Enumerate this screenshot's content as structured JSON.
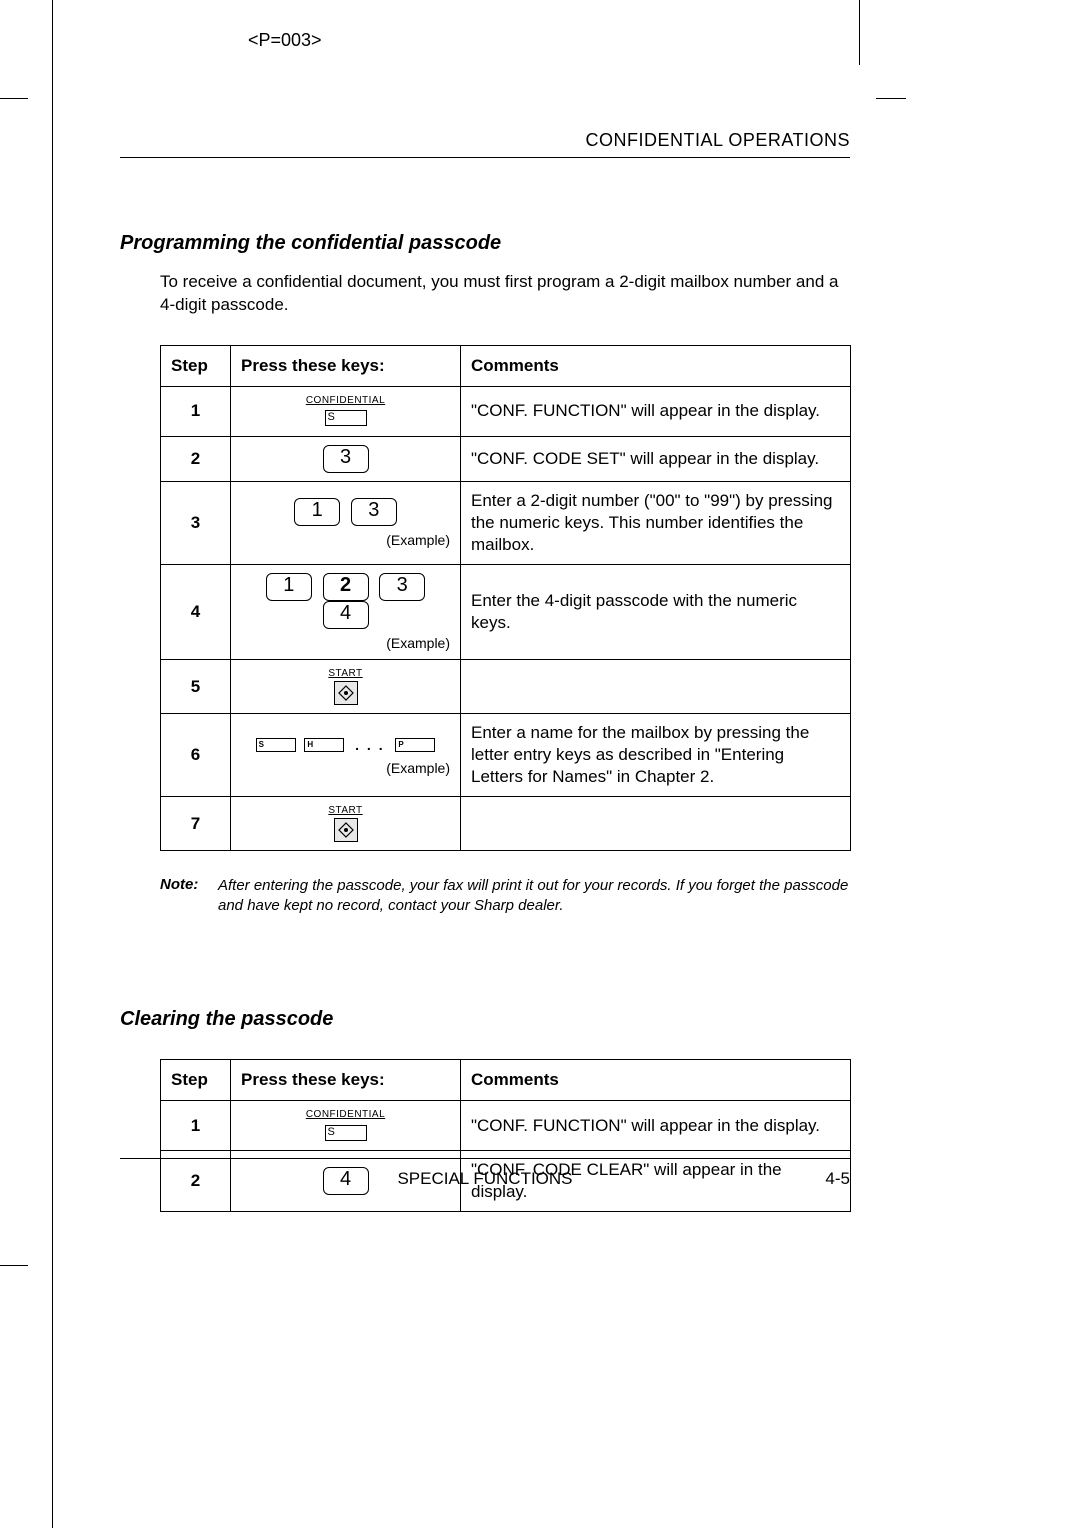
{
  "page_code": "<P=003>",
  "running_header": "CONFIDENTIAL OPERATIONS",
  "section1": {
    "title": "Programming the confidential passcode",
    "intro": "To receive a confidential document, you must first program a 2-digit mailbox number and a 4-digit passcode.",
    "headers": {
      "step": "Step",
      "keys": "Press these keys:",
      "comments": "Comments"
    },
    "rows": [
      {
        "step": "1",
        "key_type": "confidential",
        "conf_label": "CONFIDENTIAL",
        "conf_key": "S",
        "comment": "\"CONF. FUNCTION\" will appear in the display."
      },
      {
        "step": "2",
        "key_type": "numeric",
        "keys": [
          "3"
        ],
        "comment": "\"CONF. CODE SET\" will appear in the display."
      },
      {
        "step": "3",
        "key_type": "numeric-example",
        "keys": [
          "1",
          "3"
        ],
        "example": "(Example)",
        "comment": "Enter a 2-digit number (\"00\" to \"99\") by pressing the numeric keys. This number identifies the mailbox."
      },
      {
        "step": "4",
        "key_type": "numeric-example",
        "keys": [
          "1",
          "2",
          "3",
          "4"
        ],
        "bold_index": 1,
        "example": "(Example)",
        "comment": "Enter the 4-digit passcode with the numeric keys."
      },
      {
        "step": "5",
        "key_type": "start",
        "start_label": "START",
        "comment": ""
      },
      {
        "step": "6",
        "key_type": "letters-example",
        "letter_keys": [
          "S",
          "H",
          "P"
        ],
        "ellipsis": ". . .",
        "example": "(Example)",
        "comment": "Enter a name for the mailbox by pressing the letter entry keys as described in \"Entering Letters for Names\" in Chapter 2."
      },
      {
        "step": "7",
        "key_type": "start",
        "start_label": "START",
        "comment": ""
      }
    ]
  },
  "note": {
    "label": "Note:",
    "text": "After entering the passcode, your fax will print it out for your records. If you forget the passcode and have kept no record, contact your Sharp dealer."
  },
  "section2": {
    "title": "Clearing the passcode",
    "headers": {
      "step": "Step",
      "keys": "Press these keys:",
      "comments": "Comments"
    },
    "rows": [
      {
        "step": "1",
        "key_type": "confidential",
        "conf_label": "CONFIDENTIAL",
        "conf_key": "S",
        "comment": "\"CONF. FUNCTION\" will appear in the display."
      },
      {
        "step": "2",
        "key_type": "numeric",
        "keys": [
          "4"
        ],
        "comment": "\"CONF. CODE CLEAR\" will appear in the display."
      }
    ]
  },
  "footer": {
    "center": "SPECIAL FUNCTIONS",
    "right": "4-5"
  }
}
